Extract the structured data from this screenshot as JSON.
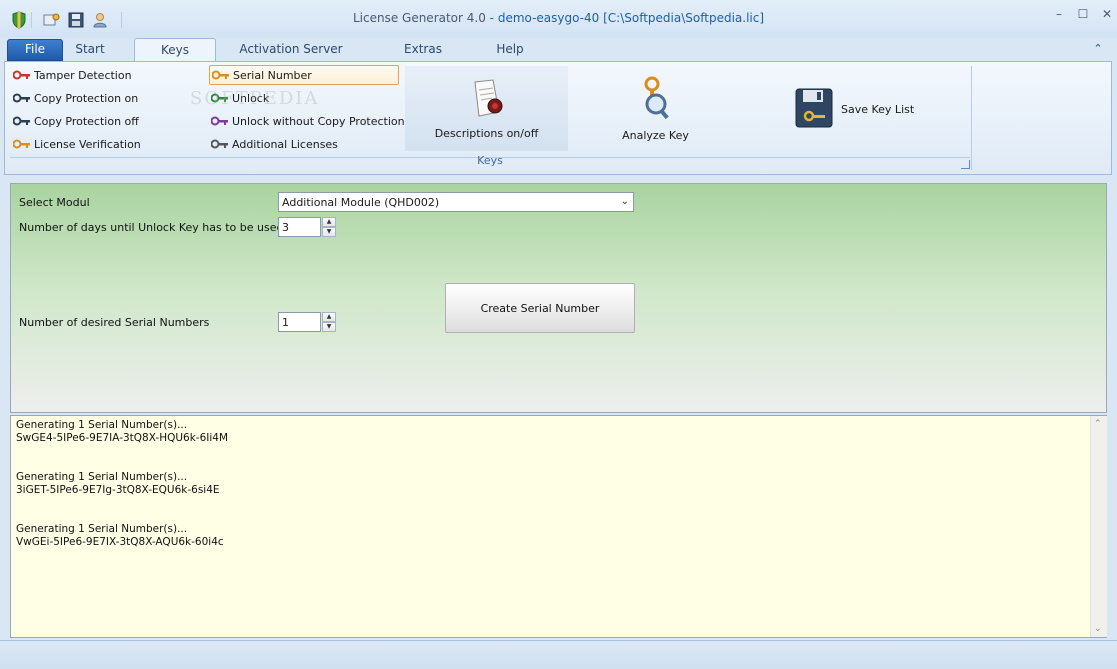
{
  "window": {
    "title_app": "License Generator 4.0",
    "title_sep": " - ",
    "title_file": "demo-easygo-40 [C:\\Softpedia\\Softpedia.lic]",
    "min": "–",
    "max": "☐",
    "close": "✕"
  },
  "tabs": {
    "file": "File",
    "start": "Start",
    "keys": "Keys",
    "activation": "Activation Server",
    "extras": "Extras",
    "help": "Help",
    "collapse": "⌃"
  },
  "ribbon": {
    "left_items": [
      "Tamper Detection",
      "Copy Protection on",
      "Copy Protection off",
      "License Verification"
    ],
    "mid_items": [
      "Serial Number",
      "Unlock",
      "Unlock without Copy Protection",
      "Additional Licenses"
    ],
    "descriptions": "Descriptions on/off",
    "analyze": "Analyze Key",
    "save": "Save Key List",
    "group_label": "Keys",
    "watermark": "SOFTPEDIA"
  },
  "form": {
    "select_modul_label": "Select Modul",
    "select_modul_value": "Additional Module (QHD002)",
    "days_label": "Number of days until Unlock Key has to be used",
    "days_value": "3",
    "serials_label": "Number of desired Serial Numbers",
    "serials_value": "1",
    "create_button": "Create Serial Number"
  },
  "output": [
    {
      "msg": "Generating 1 Serial Number(s)...",
      "key": "SwGE4-5IPe6-9E7IA-3tQ8X-HQU6k-6Ii4M"
    },
    {
      "msg": "Generating 1 Serial Number(s)...",
      "key": "3iGET-5IPe6-9E7Ig-3tQ8X-EQU6k-6si4E"
    },
    {
      "msg": "Generating 1 Serial Number(s)...",
      "key": "VwGEi-5IPe6-9E7IX-3tQ8X-AQU6k-60i4c"
    }
  ],
  "colors": {
    "accent": "#1e5aa8",
    "panel_green": "#a9d3a0",
    "output_bg": "#ffffe6"
  }
}
